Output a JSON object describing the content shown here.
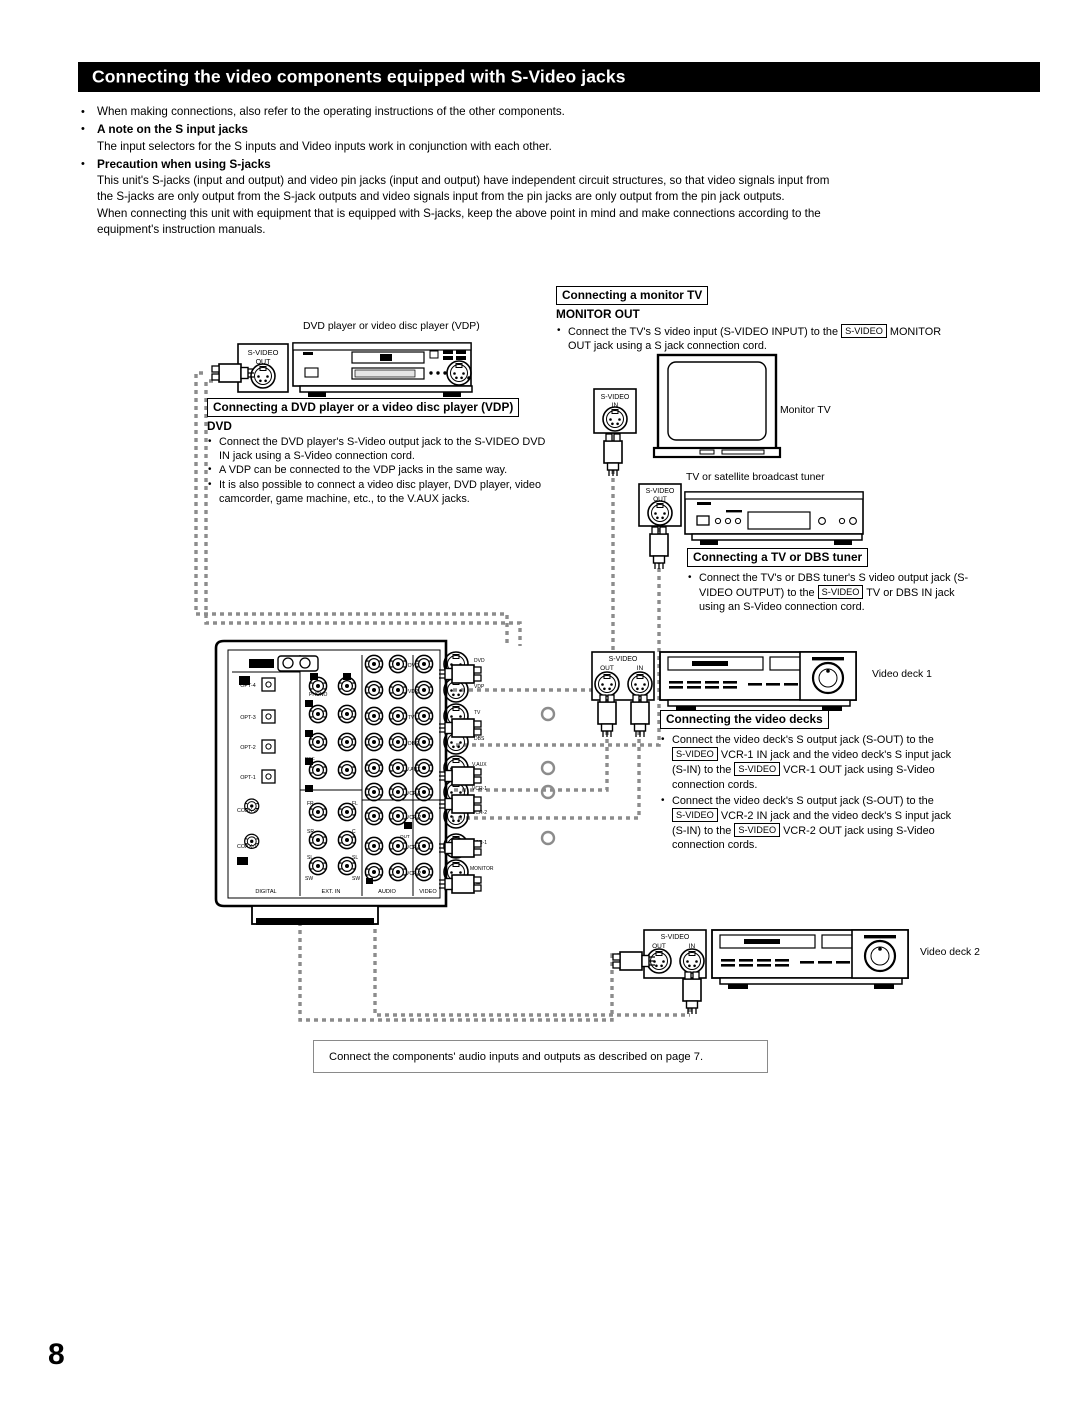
{
  "page": {
    "number": "8",
    "header_title": "Connecting the video components equipped with S-Video jacks"
  },
  "intro": {
    "bullet1": "When making connections, also refer to the operating instructions of the other components.",
    "bullet2_heading": "A note on the S input jacks",
    "bullet2_body": "The input selectors for the S inputs and Video inputs work in conjunction with each other.",
    "bullet3_heading": "Precaution when using S-jacks",
    "bullet3_line1": "This unit's S-jacks (input and output) and video pin jacks (input and output) have independent circuit structures, so that video signals input  from",
    "bullet3_line2": "the S-jacks are only output from the S-jack outputs and video signals input from the pin jacks are only output from the pin jack outputs.",
    "bullet3_line3": "When connecting this unit with equipment that is equipped with S-jacks, keep the above point in mind and make connections according to the",
    "bullet3_line4": "equipment's instruction manuals."
  },
  "monitor_section": {
    "box_heading": "Connecting a monitor TV",
    "sub_heading": "MONITOR OUT",
    "bullet_a": "Connect the TV's S video input (S-VIDEO INPUT) to the",
    "tag": "S-VIDEO",
    "bullet_b": "MONITOR",
    "bullet_c": "OUT jack using a S jack connection cord."
  },
  "dvd_section": {
    "box_heading": "Connecting a DVD player or a video disc player (VDP)",
    "sub_heading": "DVD",
    "bullets": [
      "Connect the DVD player's S-Video output jack to the S-VIDEO DVD IN jack using a S-Video connection cord.",
      "A VDP can be connected to the VDP jacks in the same way.",
      "It is also possible to connect a video disc player, DVD player, video camcorder, game machine, etc., to the V.AUX jacks."
    ]
  },
  "tuner_section": {
    "box_heading": "Connecting a TV or DBS tuner",
    "bullet_a": "Connect the TV's or DBS tuner's S video output jack (S-",
    "bullet_b": "VIDEO OUTPUT) to the",
    "tag": "S-VIDEO",
    "bullet_c": "TV or DBS IN jack",
    "bullet_d": "using an S-Video connection cord."
  },
  "decks_section": {
    "box_heading": "Connecting the video decks",
    "b1_p1": "Connect the video deck's S output jack (S-OUT) to the",
    "b1_tag1": "S-VIDEO",
    "b1_p2": "VCR-1 IN jack and the video deck's S input jack",
    "b1_p3": "(S-IN) to the",
    "b1_tag2": "S-VIDEO",
    "b1_p4": "VCR-1 OUT jack using S-Video",
    "b1_p5": "connection cords.",
    "b2_p1": "Connect the video deck's S output jack (S-OUT) to the",
    "b2_tag1": "S-VIDEO",
    "b2_p2": "VCR-2 IN jack and the video deck's S input jack",
    "b2_p3": "(S-IN) to the",
    "b2_tag2": "S-VIDEO",
    "b2_p4": "VCR-2 OUT jack using S-Video",
    "b2_p5": "connection cords."
  },
  "note_box": {
    "text": "Connect the components' audio inputs and outputs as described on page 7."
  },
  "device_labels": {
    "dvd_player": "DVD player or video disc player (VDP)",
    "monitor_tv": "Monitor TV",
    "tuner": "TV or satellite broadcast tuner",
    "deck1": "Video deck 1",
    "deck2": "Video deck 2"
  },
  "jack_labels": {
    "svideo": "S-VIDEO",
    "out": "OUT",
    "in": "IN"
  },
  "panel": {
    "group_names": [
      "DIGITAL",
      "EXT. IN",
      "AUDIO",
      "VIDEO"
    ],
    "digital_labels": [
      "OPT-4",
      "OPT-3",
      "OPT-2",
      "OPT-1",
      "COAX-2",
      "COAX-1"
    ],
    "digital_top": "EXT",
    "ext_in_labels": [
      "FR",
      "FL",
      "C",
      "SR",
      "SL",
      "SW"
    ],
    "video_jack_labels": [
      "DVD",
      "VDP",
      "TV",
      "DBS",
      "V.AUX",
      "VCR-1",
      "VCR-2",
      "MONITOR"
    ],
    "svideo_jack_labels": [
      "DVD",
      "VDP",
      "TV",
      "DBS",
      "V.AUX",
      "VCR-1",
      "VCR-2",
      "MONITOR"
    ],
    "out_marks": [
      "OUT",
      "IN"
    ],
    "phono_label": "PHONO",
    "s_pure": "S-PURE"
  },
  "colors": {
    "bar_bg": "#000000",
    "bar_text": "#ffffff",
    "ink": "#000000",
    "dash": "#8c8c8c",
    "note_border": "#8a8a8a"
  }
}
